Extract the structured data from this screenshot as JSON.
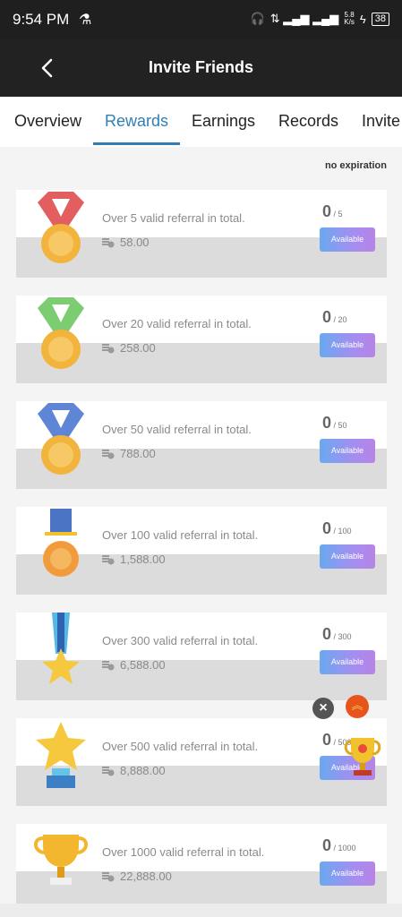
{
  "status": {
    "time": "9:54 PM",
    "battery": "38",
    "speed_top": "5.8",
    "speed_bottom": "K/s"
  },
  "appbar": {
    "title": "Invite Friends"
  },
  "tabs": [
    "Overview",
    "Rewards",
    "Earnings",
    "Records",
    "Invite"
  ],
  "expiry": "no expiration",
  "rewards": [
    {
      "desc": "Over 5 valid referral in total.",
      "amount": "58.00",
      "current": "0",
      "target": "/ 5",
      "button": "Available",
      "medal": "red-ribbon-medal-icon",
      "colors": {
        "ribbon": "#e35f5f",
        "medal": "#f2b43c"
      }
    },
    {
      "desc": "Over 20 valid referral in total.",
      "amount": "258.00",
      "current": "0",
      "target": "/ 20",
      "button": "Available",
      "medal": "green-ribbon-medal-icon",
      "colors": {
        "ribbon": "#7ccd72",
        "medal": "#f2b43c"
      }
    },
    {
      "desc": "Over 50 valid referral in total.",
      "amount": "788.00",
      "current": "0",
      "target": "/ 50",
      "button": "Available",
      "medal": "blue-ribbon-medal-icon",
      "colors": {
        "ribbon": "#5f86d6",
        "medal": "#f2b43c"
      }
    },
    {
      "desc": "Over 100 valid referral in total.",
      "amount": "1,588.00",
      "current": "0",
      "target": "/ 100",
      "button": "Available",
      "medal": "hanging-medal-icon",
      "colors": {
        "ribbon": "#4c74c4",
        "medal": "#f29b3c"
      }
    },
    {
      "desc": "Over 300 valid referral in total.",
      "amount": "6,588.00",
      "current": "0",
      "target": "/ 300",
      "button": "Available",
      "medal": "star-medal-icon",
      "colors": {
        "ribbon": "#56b8e4",
        "medal": "#f6c83d"
      }
    },
    {
      "desc": "Over 500 valid referral in total.",
      "amount": "8,888.00",
      "current": "0",
      "target": "/ 500",
      "button": "Available",
      "medal": "star-trophy-icon",
      "colors": {
        "ribbon": "#3d7fc4",
        "medal": "#f6c83d"
      }
    },
    {
      "desc": "Over 1000 valid referral in total.",
      "amount": "22,888.00",
      "current": "0",
      "target": "/ 1000",
      "button": "Available",
      "medal": "gold-cup-trophy-icon",
      "colors": {
        "ribbon": "#e9e9e9",
        "medal": "#f3b62f"
      }
    }
  ],
  "floating": {
    "close_label": "×",
    "top_label": "︽"
  }
}
